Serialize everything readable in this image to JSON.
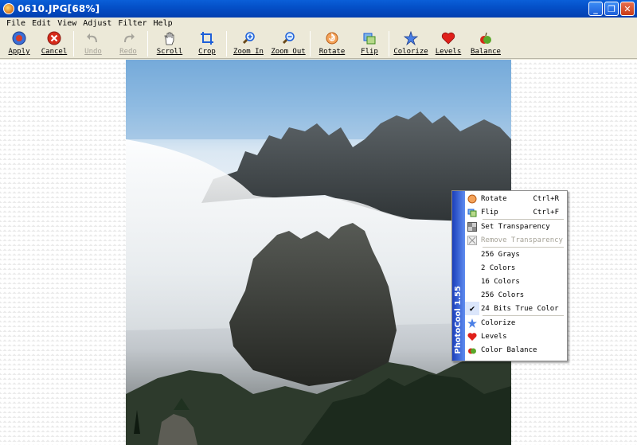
{
  "window": {
    "title": "0610.JPG[68%]",
    "controls": [
      "_",
      "❐",
      "✕"
    ]
  },
  "menu": [
    "File",
    "Edit",
    "View",
    "Adjust",
    "Filter",
    "Help"
  ],
  "toolbar": {
    "apply": "Apply",
    "cancel": "Cancel",
    "undo": "Undo",
    "redo": "Redo",
    "scroll": "Scroll",
    "crop": "Crop",
    "zoom_in": "Zoom In",
    "zoom_out": "Zoom Out",
    "rotate": "Rotate",
    "flip": "Flip",
    "colorize": "Colorize",
    "levels": "Levels",
    "balance": "Balance"
  },
  "context_menu": {
    "brand": "PhotoCool 1.55",
    "items": [
      {
        "label": "Rotate",
        "shortcut": "Ctrl+R",
        "icon": "rotate-icon"
      },
      {
        "label": "Flip",
        "shortcut": "Ctrl+F",
        "icon": "flip-icon"
      },
      {
        "label": "Set Transparency",
        "shortcut": "",
        "icon": "transparency-icon"
      },
      {
        "label": "Remove Transparency",
        "shortcut": "",
        "icon": "remove-transparency-icon"
      },
      {
        "label": "256 Grays",
        "shortcut": ""
      },
      {
        "label": "2 Colors",
        "shortcut": ""
      },
      {
        "label": "16 Colors",
        "shortcut": ""
      },
      {
        "label": "256 Colors",
        "shortcut": ""
      },
      {
        "label": "24 Bits True Color",
        "shortcut": ""
      },
      {
        "label": "Colorize",
        "shortcut": "",
        "icon": "colorize-icon"
      },
      {
        "label": "Levels",
        "shortcut": "",
        "icon": "levels-icon"
      },
      {
        "label": "Color Balance",
        "shortcut": "",
        "icon": "balance-icon"
      }
    ]
  }
}
